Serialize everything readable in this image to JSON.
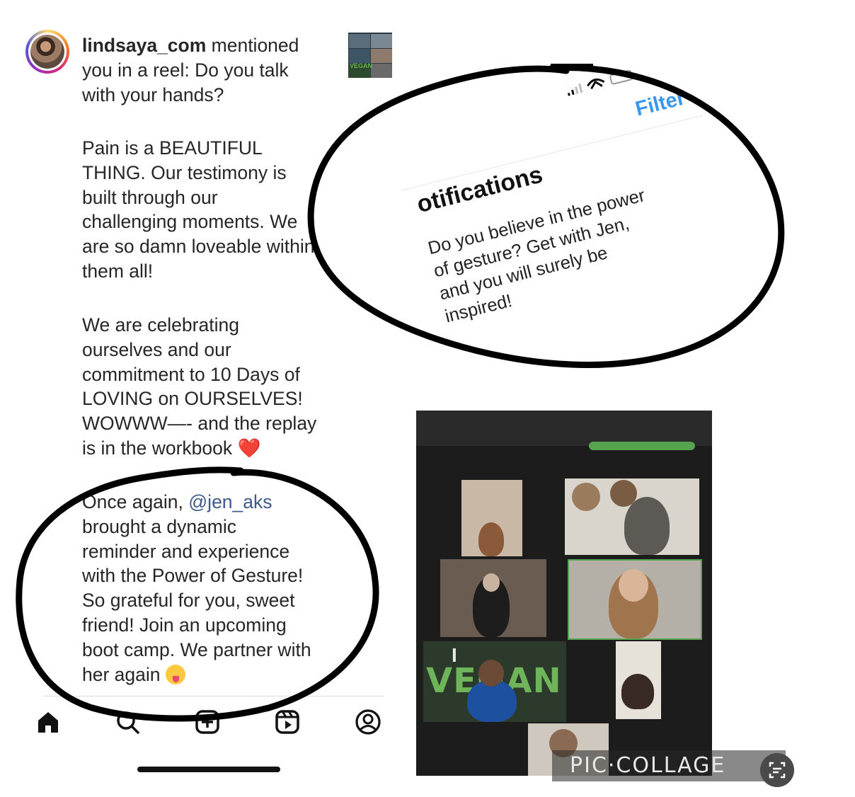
{
  "notification": {
    "username": "lindsaya_com",
    "action": " mentioned\nyou in a reel: Do you talk\nwith your hands?"
  },
  "caption": {
    "para1": "Pain is a BEAUTIFUL\nTHING. Our testimony is\nbuilt through our\nchallenging moments. We\nare so damn loveable within\nthem all!",
    "para2": "We are celebrating\nourselves and our\ncommitment to 10 Days of\nLOVING on OURSELVES!\nWOWWW—- and the replay\nis in the workbook ",
    "para2_emoji": "❤️",
    "para3_start": "Once again, ",
    "para3_mention": "@jen_aks",
    "para3_rest": "\nbrought a dynamic\nreminder and experience\nwith the Power of Gesture!\nSo grateful for you, sweet\nfriend! Join an upcoming\nboot camp. We partner with\nher again "
  },
  "reel_thumbnail": {
    "label": "VEGAN"
  },
  "bottom_nav": {
    "items": [
      "home-icon",
      "search-icon",
      "create-icon",
      "reels-icon",
      "profile-icon"
    ]
  },
  "notifications_screen": {
    "filter_label": "Filter",
    "title": "otifications",
    "body": "Do you believe in the power\nof gesture? Get with Jen,\nand you will surely be\ninspired!"
  },
  "video_call": {
    "vegan_sign": "VEGAN",
    "vegan_sign_small": "I"
  },
  "watermark": {
    "text": "PIC·COLLAGE"
  },
  "colors": {
    "text": "#262626",
    "mention_link": "#3d5a8a",
    "filter_blue": "#3897f0",
    "ink": "#000000"
  }
}
